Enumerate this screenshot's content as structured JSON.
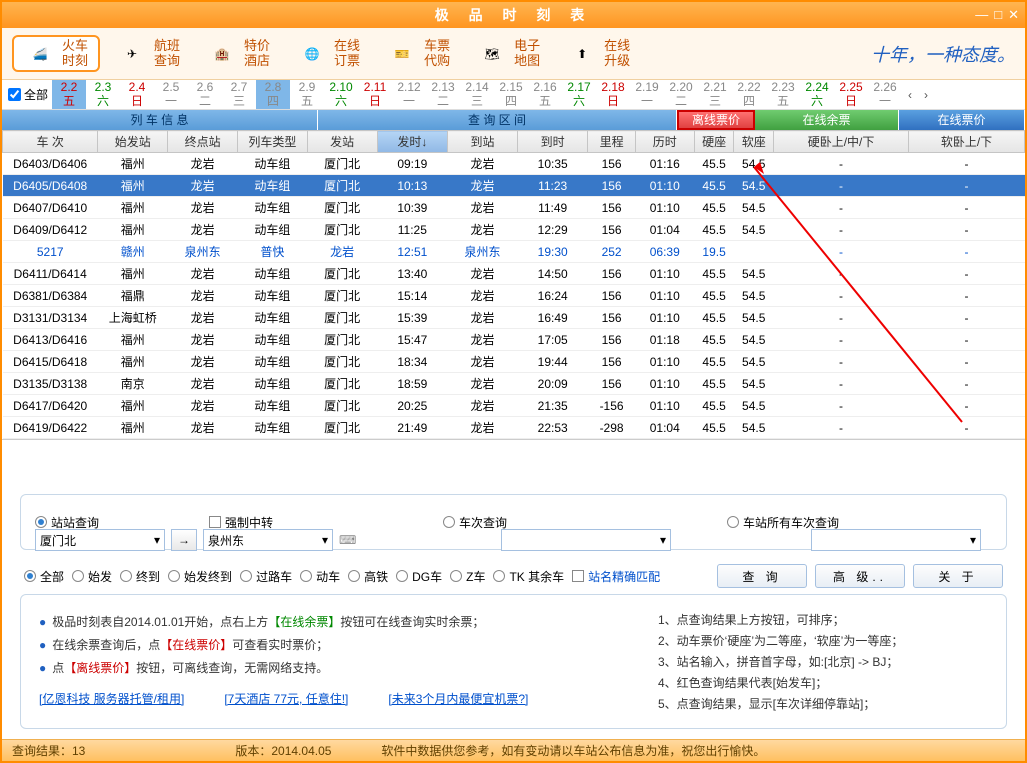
{
  "title": "极 品 时 刻 表",
  "toolbar": [
    {
      "label": "火车\n时刻",
      "icon": "train"
    },
    {
      "label": "航班\n查询",
      "icon": "plane"
    },
    {
      "label": "特价\n酒店",
      "icon": "hotel"
    },
    {
      "label": "在线\n订票",
      "icon": "globe"
    },
    {
      "label": "车票\n代购",
      "icon": "ticket"
    },
    {
      "label": "电子\n地图",
      "icon": "map"
    },
    {
      "label": "在线\n升级",
      "icon": "upgrade"
    }
  ],
  "slogan": "十年，一种态度。",
  "all_label": "全部",
  "dates": [
    {
      "d": "2.2",
      "w": "五",
      "sel": true,
      "cls": "red"
    },
    {
      "d": "2.3",
      "w": "六",
      "cls": "green"
    },
    {
      "d": "2.4",
      "w": "日",
      "cls": "red"
    },
    {
      "d": "2.5",
      "w": "一",
      "cls": "gray"
    },
    {
      "d": "2.6",
      "w": "二",
      "cls": "gray"
    },
    {
      "d": "2.7",
      "w": "三",
      "cls": "gray"
    },
    {
      "d": "2.8",
      "w": "四",
      "sel": true,
      "cls": "gray"
    },
    {
      "d": "2.9",
      "w": "五",
      "cls": "gray"
    },
    {
      "d": "2.10",
      "w": "六",
      "cls": "green"
    },
    {
      "d": "2.11",
      "w": "日",
      "cls": "red"
    },
    {
      "d": "2.12",
      "w": "一",
      "cls": "gray"
    },
    {
      "d": "2.13",
      "w": "二",
      "cls": "gray"
    },
    {
      "d": "2.14",
      "w": "三",
      "cls": "gray"
    },
    {
      "d": "2.15",
      "w": "四",
      "cls": "gray"
    },
    {
      "d": "2.16",
      "w": "五",
      "cls": "gray"
    },
    {
      "d": "2.17",
      "w": "六",
      "cls": "green"
    },
    {
      "d": "2.18",
      "w": "日",
      "cls": "red"
    },
    {
      "d": "2.19",
      "w": "一",
      "cls": "gray"
    },
    {
      "d": "2.20",
      "w": "二",
      "cls": "gray"
    },
    {
      "d": "2.21",
      "w": "三",
      "cls": "gray"
    },
    {
      "d": "2.22",
      "w": "四",
      "cls": "gray"
    },
    {
      "d": "2.23",
      "w": "五",
      "cls": "gray"
    },
    {
      "d": "2.24",
      "w": "六",
      "cls": "green"
    },
    {
      "d": "2.25",
      "w": "日",
      "cls": "red"
    },
    {
      "d": "2.26",
      "w": "一",
      "cls": "gray"
    }
  ],
  "header_groups": {
    "g1": "列 车 信 息",
    "g2": "查 询 区 间",
    "g3": "离线票价",
    "g4": "在线余票",
    "g5": "在线票价"
  },
  "columns": [
    "车 次",
    "始发站",
    "终点站",
    "列车类型",
    "发站",
    "发时↓",
    "到站",
    "到时",
    "里程",
    "历时",
    "硬座",
    "软座",
    "硬卧上/中/下",
    "软卧上/下"
  ],
  "rows": [
    {
      "c": [
        "D6403/D6406",
        "福州",
        "龙岩",
        "动车组",
        "厦门北",
        "09:19",
        "龙岩",
        "10:35",
        "156",
        "01:16",
        "45.5",
        "54.5",
        "-",
        "-"
      ]
    },
    {
      "c": [
        "D6405/D6408",
        "福州",
        "龙岩",
        "动车组",
        "厦门北",
        "10:13",
        "龙岩",
        "11:23",
        "156",
        "01:10",
        "45.5",
        "54.5",
        "-",
        "-"
      ],
      "sel": true
    },
    {
      "c": [
        "D6407/D6410",
        "福州",
        "龙岩",
        "动车组",
        "厦门北",
        "10:39",
        "龙岩",
        "11:49",
        "156",
        "01:10",
        "45.5",
        "54.5",
        "-",
        "-"
      ]
    },
    {
      "c": [
        "D6409/D6412",
        "福州",
        "龙岩",
        "动车组",
        "厦门北",
        "11:25",
        "龙岩",
        "12:29",
        "156",
        "01:04",
        "45.5",
        "54.5",
        "-",
        "-"
      ]
    },
    {
      "c": [
        "5217",
        "赣州",
        "泉州东",
        "普快",
        "龙岩",
        "12:51",
        "泉州东",
        "19:30",
        "252",
        "06:39",
        "19.5",
        "",
        "-",
        "-"
      ],
      "blue": true
    },
    {
      "c": [
        "D6411/D6414",
        "福州",
        "龙岩",
        "动车组",
        "厦门北",
        "13:40",
        "龙岩",
        "14:50",
        "156",
        "01:10",
        "45.5",
        "54.5",
        "-",
        "-"
      ]
    },
    {
      "c": [
        "D6381/D6384",
        "福鼎",
        "龙岩",
        "动车组",
        "厦门北",
        "15:14",
        "龙岩",
        "16:24",
        "156",
        "01:10",
        "45.5",
        "54.5",
        "-",
        "-"
      ]
    },
    {
      "c": [
        "D3131/D3134",
        "上海虹桥",
        "龙岩",
        "动车组",
        "厦门北",
        "15:39",
        "龙岩",
        "16:49",
        "156",
        "01:10",
        "45.5",
        "54.5",
        "-",
        "-"
      ]
    },
    {
      "c": [
        "D6413/D6416",
        "福州",
        "龙岩",
        "动车组",
        "厦门北",
        "15:47",
        "龙岩",
        "17:05",
        "156",
        "01:18",
        "45.5",
        "54.5",
        "-",
        "-"
      ]
    },
    {
      "c": [
        "D6415/D6418",
        "福州",
        "龙岩",
        "动车组",
        "厦门北",
        "18:34",
        "龙岩",
        "19:44",
        "156",
        "01:10",
        "45.5",
        "54.5",
        "-",
        "-"
      ]
    },
    {
      "c": [
        "D3135/D3138",
        "南京",
        "龙岩",
        "动车组",
        "厦门北",
        "18:59",
        "龙岩",
        "20:09",
        "156",
        "01:10",
        "45.5",
        "54.5",
        "-",
        "-"
      ]
    },
    {
      "c": [
        "D6417/D6420",
        "福州",
        "龙岩",
        "动车组",
        "厦门北",
        "20:25",
        "龙岩",
        "21:35",
        "-156",
        "01:10",
        "45.5",
        "54.5",
        "-",
        "-"
      ]
    },
    {
      "c": [
        "D6419/D6422",
        "福州",
        "龙岩",
        "动车组",
        "厦门北",
        "21:49",
        "龙岩",
        "22:53",
        "-298",
        "01:04",
        "45.5",
        "54.5",
        "-",
        "-"
      ]
    }
  ],
  "query": {
    "opt_station": "站站查询",
    "opt_force": "强制中转",
    "opt_train": "车次查询",
    "opt_allstation": "车站所有车次查询",
    "from": "厦门北",
    "to": "泉州东",
    "filter_all": "全部",
    "filter_start": "始发",
    "filter_end": "终到",
    "filter_startend": "始发终到",
    "filter_pass": "过路车",
    "filter_d": "动车",
    "filter_g": "高铁",
    "filter_dg": "DG车",
    "filter_z": "Z车",
    "filter_tk": "TK 其余车",
    "exact": "站名精确匹配",
    "btn_query": "查 询",
    "btn_adv": "高 级..",
    "btn_about": "关 于"
  },
  "info": {
    "l1a": "极品时刻表自2014.01.01开始，点右上方",
    "l1b": "【在线余票】",
    "l1c": "按钮可在线查询实时余票；",
    "l2a": "在线余票查询后，点",
    "l2b": "【在线票价】",
    "l2c": "可查看实时票价；",
    "l3a": "点",
    "l3b": "【离线票价】",
    "l3c": "按钮，可离线查询，无需网络支持。",
    "r1": "1、点查询结果上方按钮，可排序；",
    "r2": "2、动车票价‘硬座’为二等座，‘软座’为一等座；",
    "r3": "3、站名输入，拼音首字母，如:[北京] -> BJ；",
    "r4": "4、红色查询结果代表[始发车]；",
    "r5": "5、点查询结果，显示[车次详细停靠站]；",
    "link1": "[亿恩科技 服务器托管/租用]",
    "link2": "[7天酒店 77元, 任意住!]",
    "link3": "[未来3个月内最便宜机票?]"
  },
  "status": {
    "result": "查询结果：13",
    "version": "版本：2014.04.05",
    "note": "软件中数据供您参考，如有变动请以车站公布信息为准，祝您出行愉快。"
  }
}
